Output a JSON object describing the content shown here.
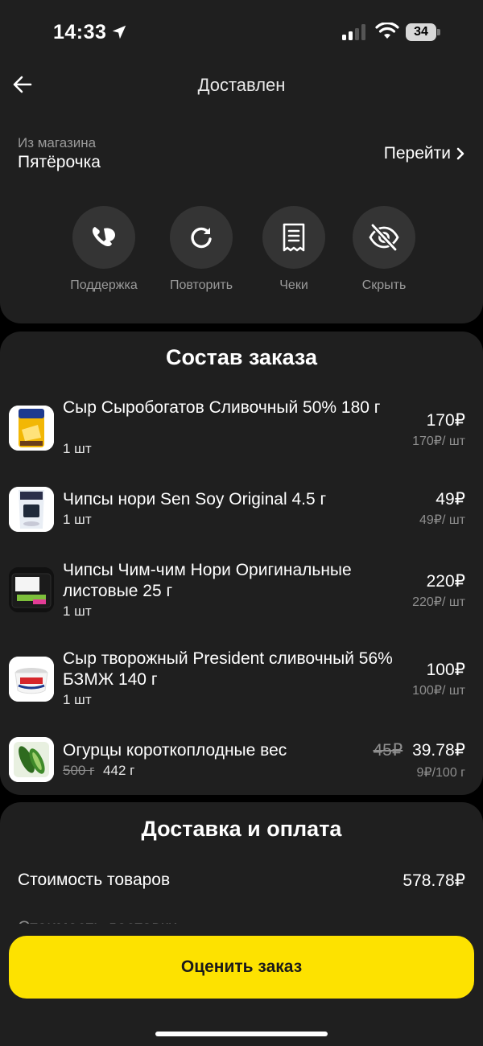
{
  "status_bar": {
    "time": "14:33",
    "battery": "34"
  },
  "header": {
    "title": "Доставлен"
  },
  "store": {
    "caption": "Из магазина",
    "name": "Пятёрочка",
    "link_label": "Перейти"
  },
  "actions": [
    {
      "label": "Поддержка",
      "icon": "support-icon"
    },
    {
      "label": "Повторить",
      "icon": "repeat-icon"
    },
    {
      "label": "Чеки",
      "icon": "receipt-icon"
    },
    {
      "label": "Скрыть",
      "icon": "hide-icon"
    }
  ],
  "order": {
    "title": "Состав заказа",
    "items": [
      {
        "name": "Сыр Сыробогатов Сливочный 50% 180 г",
        "qty": "1 шт",
        "price": "170₽",
        "unit_price": "170₽/ шт"
      },
      {
        "name": "Чипсы нори Sen Soy Original 4.5 г",
        "qty": "1 шт",
        "price": "49₽",
        "unit_price": "49₽/ шт"
      },
      {
        "name": "Чипсы Чим-чим Нори Оригинальные листовые 25 г",
        "qty": "1 шт",
        "price": "220₽",
        "unit_price": "220₽/ шт"
      },
      {
        "name": "Сыр творожный President сливочный 56% БЗМЖ 140 г",
        "qty": "1 шт",
        "price": "100₽",
        "unit_price": "100₽/ шт"
      },
      {
        "name": "Огурцы короткоплодные вес",
        "qty_old": "500 г",
        "qty": "442 г",
        "price_old": "45₽",
        "price": "39.78₽",
        "unit_price": "9₽/100 г"
      }
    ]
  },
  "delivery": {
    "title": "Доставка и оплата",
    "goods_cost_label": "Стоимость товаров",
    "goods_cost_value": "578.78₽",
    "delivery_cost_label": "Стоимость доставки"
  },
  "rate_button": {
    "label": "Оценить заказ"
  },
  "colors": {
    "accent": "#fde200",
    "card": "#1f1f1f",
    "background": "#000000"
  }
}
